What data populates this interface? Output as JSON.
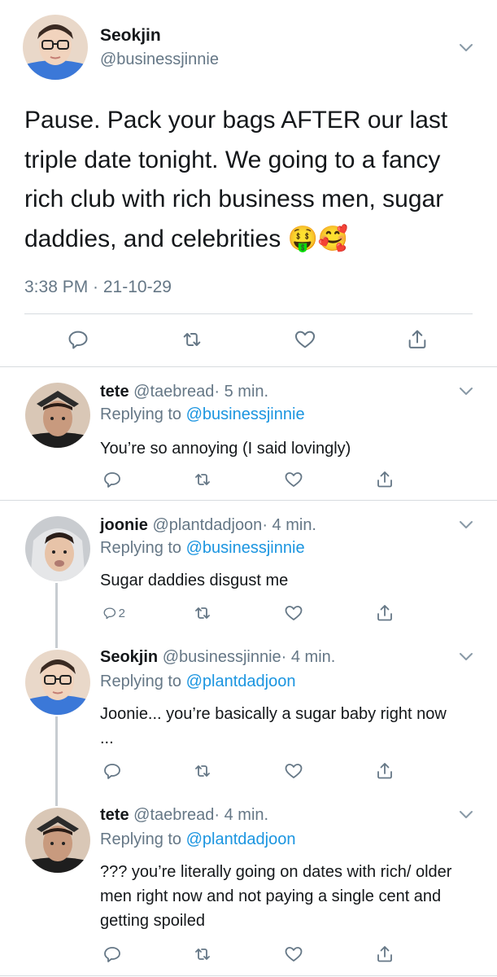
{
  "main_tweet": {
    "display_name": "Seokjin",
    "handle": "@businessjinnie",
    "text": "Pause. Pack your bags AFTER our last triple date tonight. We going to a fancy rich club with rich business men, sugar daddies, and celebrities 🤑🥰",
    "timestamp": "3:38 PM · 21-10-29"
  },
  "replies": [
    {
      "display_name": "tete",
      "handle": "@taebread",
      "time": "· 5 min.",
      "replying_prefix": "Replying to",
      "replying_to": "@businessjinnie",
      "text": "You’re so annoying (I said lovingly)",
      "reply_count": ""
    },
    {
      "display_name": "joonie",
      "handle": "@plantdadjoon",
      "time": "· 4 min.",
      "replying_prefix": "Replying to",
      "replying_to": "@businessjinnie",
      "text": "Sugar daddies disgust me",
      "reply_count": "2"
    },
    {
      "display_name": "Seokjin",
      "handle": "@businessjinnie",
      "time": "· 4 min.",
      "replying_prefix": "Replying to",
      "replying_to": "@plantdadjoon",
      "text": "Joonie... you’re basically a sugar baby right now ...",
      "reply_count": ""
    },
    {
      "display_name": "tete",
      "handle": "@taebread",
      "time": "· 4 min.",
      "replying_prefix": "Replying to",
      "replying_to": "@plantdadjoon",
      "text": "??? you’re literally going on dates with rich/ older men right now and not paying a single cent and getting spoiled",
      "reply_count": ""
    }
  ],
  "colors": {
    "link": "#1b95e0",
    "muted": "#657786",
    "divider": "#d7dbdf",
    "icon": "#657786"
  },
  "icons": [
    "chevron-down-icon",
    "reply-icon",
    "retweet-icon",
    "like-icon",
    "share-icon"
  ]
}
